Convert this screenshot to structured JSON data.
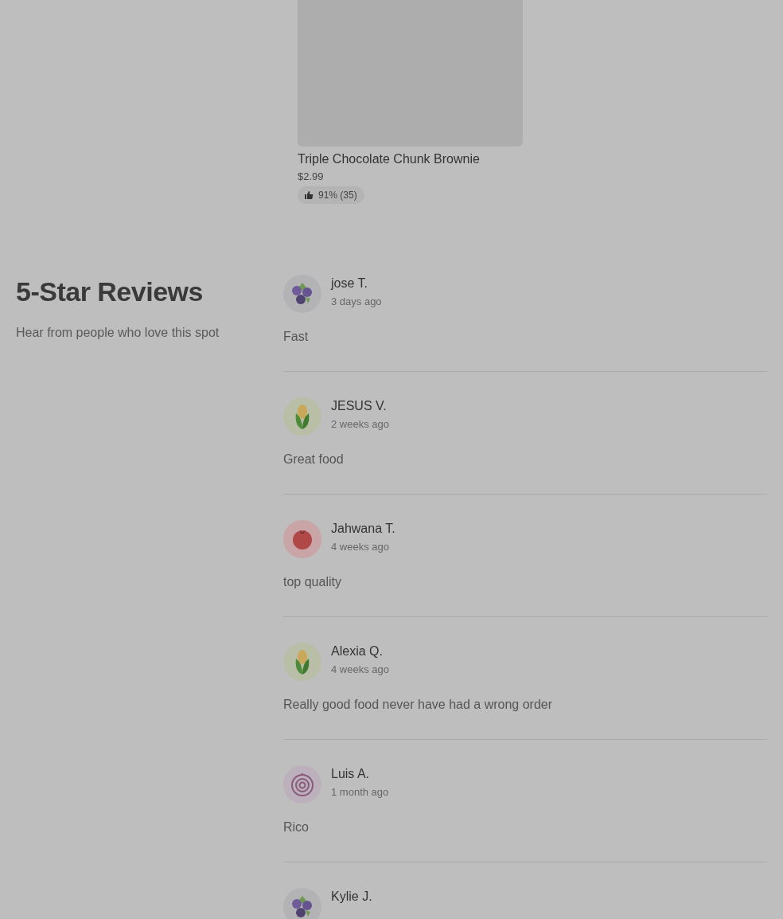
{
  "product": {
    "name": "Triple Chocolate Chunk Brownie",
    "price": "$2.99",
    "rating": "91% (35)"
  },
  "reviews_section": {
    "title": "5-Star Reviews",
    "subtitle": "Hear from people who love this spot",
    "reviews": [
      {
        "name": "jose T.",
        "time": "3 days ago",
        "text": "Fast",
        "kind": "blueberry"
      },
      {
        "name": "JESUS V.",
        "time": "2 weeks ago",
        "text": "Great food",
        "kind": "corn"
      },
      {
        "name": "Jahwana T.",
        "time": "4 weeks ago",
        "text": "top quality",
        "kind": "tomato"
      },
      {
        "name": "Alexia Q.",
        "time": "4 weeks ago",
        "text": "Really good food never have had a wrong order",
        "kind": "corn"
      },
      {
        "name": "Luis A.",
        "time": "1 month ago",
        "text": "Rico",
        "kind": "onion"
      },
      {
        "name": "Kylie J.",
        "kind": "blueberry"
      }
    ]
  }
}
